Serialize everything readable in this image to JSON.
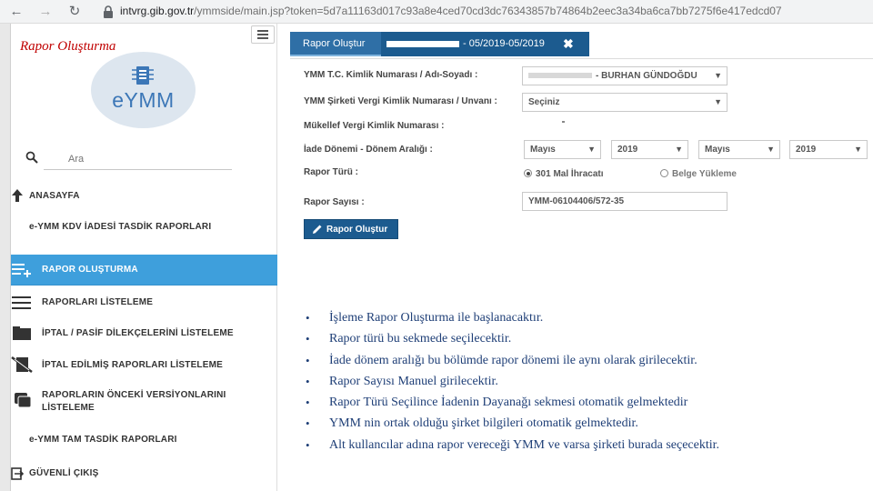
{
  "browser": {
    "back_glyph": "←",
    "forward_glyph": "→",
    "reload_glyph": "↻",
    "url_host": "intvrg.gib.gov.tr",
    "url_rest": "/ymmside/main.jsp?token=5d7a11163d017c93a8e4ced70cd3dc76343857b74864b2eec3a34ba6ca7bb7275f6e417edcd07"
  },
  "slide_title": "Rapor Oluşturma",
  "sidebar": {
    "logo_text": "eYMM",
    "search_placeholder": "Ara",
    "anasayfa": "ANASAYFA",
    "section_kdv": "e-YMM KDV İADESİ TASDİK RAPORLARI",
    "rapor_olusturma": "RAPOR OLUŞTURMA",
    "raporlari_listeleme": "RAPORLARI LİSTELEME",
    "iptal_pasif": "İPTAL / PASİF DİLEKÇELERİNİ LİSTELEME",
    "iptal_edilmis": "İPTAL EDİLMİŞ RAPORLARI LİSTELEME",
    "onceki_versiyonlar": "RAPORLARIN ÖNCEKİ VERSİYONLARINI LİSTELEME",
    "section_tam": "e-YMM TAM TASDİK RAPORLARI",
    "guvenli_cikis": "GÜVENLİ ÇIKIŞ"
  },
  "main": {
    "tab_label": "Rapor Oluştur",
    "tab_period": "- 05/2019-05/2019",
    "tab_close": "✖",
    "labels": {
      "ymm": "YMM T.C. Kimlik Numarası / Adı-Soyadı :",
      "sirket": "YMM Şirketi Vergi Kimlik Numarası / Unvanı :",
      "mukellef": "Mükellef Vergi Kimlik Numarası :",
      "iade": "İade Dönemi - Dönem Aralığı :",
      "rapor_turu": "Rapor Türü :",
      "rapor_sayisi": "Rapor Sayısı :"
    },
    "ymm_value": "- BURHAN GÜNDOĞDU",
    "sirket_value": "Seçiniz",
    "from_month": "Mayıs",
    "from_year": "2019",
    "to_month": "Mayıs",
    "to_year": "2019",
    "radio_ihracat": "301 Mal İhracatı",
    "radio_belge": "Belge Yükleme",
    "rapor_sayisi_value": "YMM-06104406/572-35",
    "submit_label": "Rapor Oluştur",
    "chevron_glyph": "▼"
  },
  "notes": [
    "İşleme Rapor Oluşturma ile başlanacaktır.",
    "Rapor türü bu sekmede seçilecektir.",
    "İade dönem aralığı bu bölümde rapor dönemi ile aynı olarak girilecektir.",
    "Rapor Sayısı Manuel girilecektir.",
    "Rapor Türü Seçilince İadenin Dayanağı sekmesi otomatik gelmektedir",
    "YMM nin ortak olduğu şirket bilgileri otomatik gelmektedir.",
    "Alt kullancılar adına rapor vereceği YMM ve varsa şirketi burada seçecektir."
  ],
  "bullet_glyph": "•",
  "colors": {
    "accent_blue": "#3e9fdc",
    "navy": "#1c5b8f",
    "slide_title_red": "#c00000",
    "notes_text": "#1f3f77"
  }
}
